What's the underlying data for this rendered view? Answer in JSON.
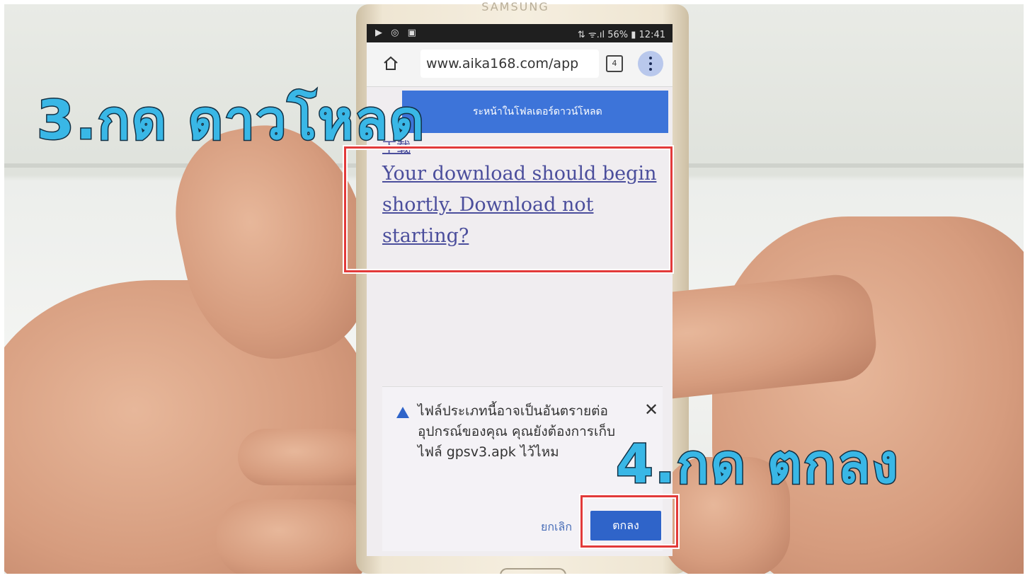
{
  "status_bar": {
    "left_icons": "▶ ◎ ▣",
    "right": "⇅ ᯤ.ıl 56% ▮ 12:41"
  },
  "phone_brand": "SAMSUNG",
  "browser": {
    "url": "www.aika168.com/app",
    "tab_count": "4",
    "home_icon": "home-icon",
    "menu_icon": "more-vert-icon"
  },
  "toast": {
    "text": "ระหน้าในโฟลเดอร์ดาวน์โหลด"
  },
  "page": {
    "small_link": "下载",
    "download_link": "Your download should begin shortly. Download not starting?"
  },
  "dialog": {
    "message": "ไฟล์ประเภทนี้อาจเป็นอันตรายต่ออุปกรณ์ของคุณ คุณยังต้องการเก็บไฟล์ gpsv3.apk ไว้ไหม",
    "close_icon": "close-icon",
    "warning_icon": "warning-icon",
    "cancel_label": "ยกเลิก",
    "ok_label": "ตกลง"
  },
  "captions": {
    "step3": "3.กด ดาวโหลด",
    "step4": "4.กด ตกลง"
  },
  "colors": {
    "caption_fill": "#39b7e6",
    "caption_outline": "#123044",
    "highlight": "#e23a3a",
    "toast_bg": "#3d74d9",
    "ok_button": "#2f64c9",
    "link": "#4b4e9c"
  }
}
